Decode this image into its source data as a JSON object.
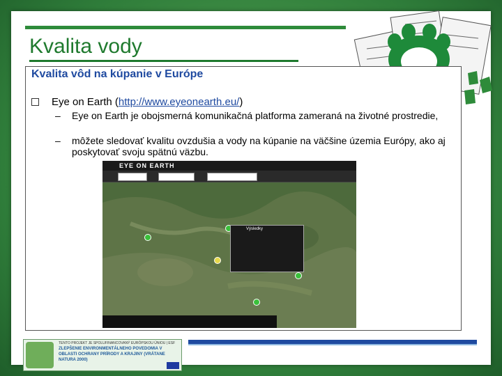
{
  "slide": {
    "title": "Kvalita vody",
    "subtitle": "Kvalita vôd na kúpanie v Európe",
    "bullet_label": "Eye on Earth",
    "bullet_paren_open": " (",
    "bullet_link": "http://www.eyeonearth.eu/",
    "bullet_paren_close": ")",
    "sub1": "Eye on Earth je obojsmerná komunikačná platforma zameraná na životné prostredie,",
    "sub2": "môžete sledovať kvalitu ovzdušia a vody na kúpanie na väčšine územia Európy, ako aj poskytovať svoju spätnú väzbu.",
    "dash": "–"
  },
  "map": {
    "brand": "EYE ON EARTH",
    "popup_title": "Výsledky"
  },
  "banner": {
    "top": "TENTO PROJEKT JE SPOLUFINANCOVANÝ EURÓPSKOU ÚNIOU | ESF",
    "text": "ZLEPŠENIE ENVIRONMENTÁLNEHO POVEDOMIA V OBLASTI OCHRANY PRÍRODY A KRAJINY (VRÁTANE NATURA 2000)"
  },
  "colors": {
    "title": "#1f7a2e",
    "subtitle": "#1f4aa0",
    "frame": "#2f7d3a"
  }
}
